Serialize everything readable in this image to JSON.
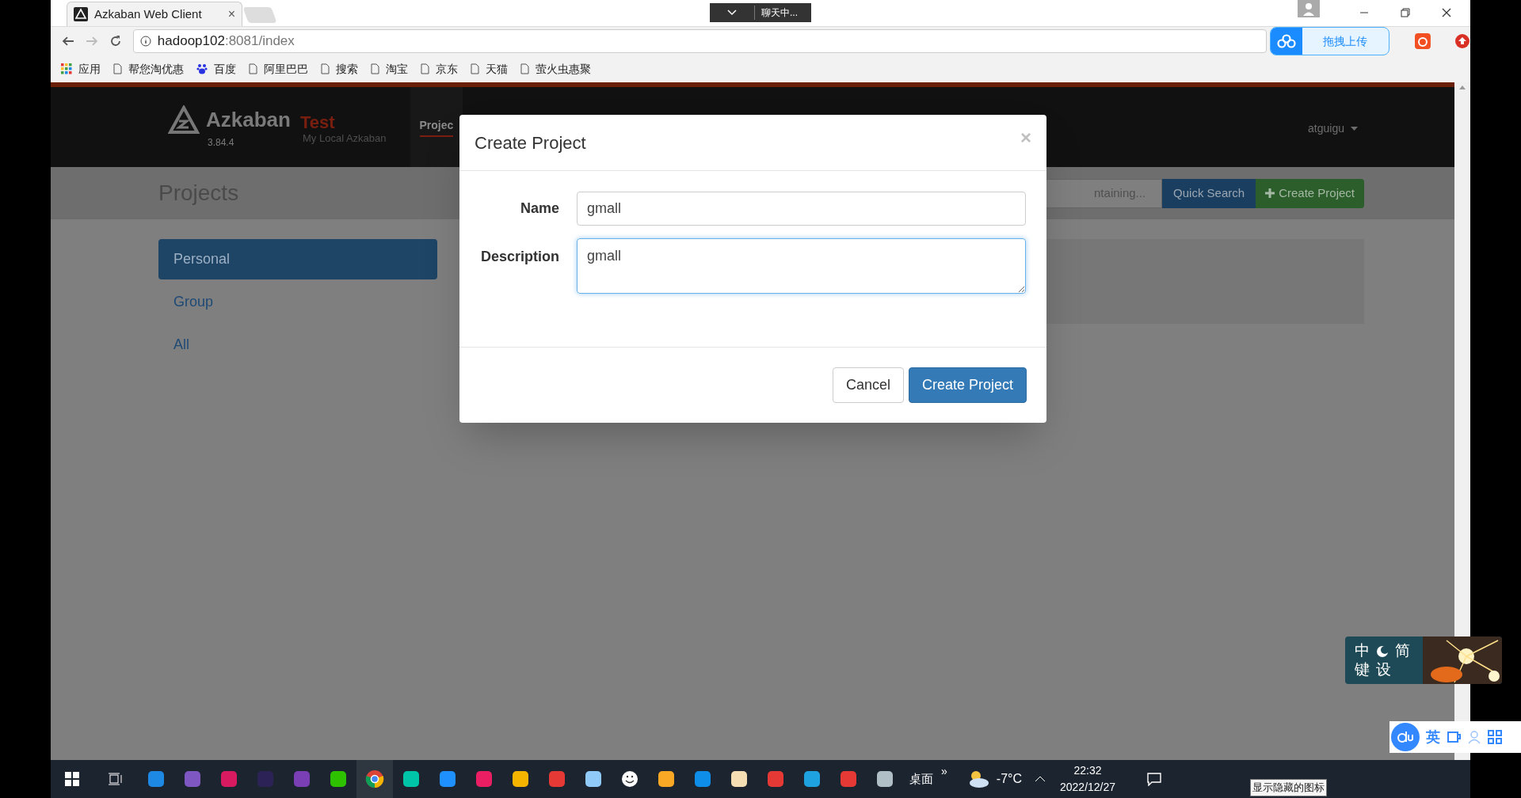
{
  "browser": {
    "tab_title": "Azkaban Web Client",
    "tab_close": "×",
    "chat_widget": "聊天中...",
    "url_host": "hadoop102",
    "url_rest": ":8081/index",
    "upload_button": "拖拽上传",
    "bookmarks": [
      {
        "label": "应用",
        "kind": "apps"
      },
      {
        "label": "帮您淘优惠",
        "kind": "page"
      },
      {
        "label": "百度",
        "kind": "paw"
      },
      {
        "label": "阿里巴巴",
        "kind": "page"
      },
      {
        "label": "搜索",
        "kind": "page"
      },
      {
        "label": "淘宝",
        "kind": "page"
      },
      {
        "label": "京东",
        "kind": "page"
      },
      {
        "label": "天猫",
        "kind": "page"
      },
      {
        "label": "萤火虫惠聚",
        "kind": "page"
      }
    ]
  },
  "header": {
    "brand": "Azkaban",
    "env": "Test",
    "version": "3.84.4",
    "env_desc": "My Local Azkaban",
    "nav": [
      {
        "label": "Projec",
        "selected": true
      }
    ],
    "user": "atguigu"
  },
  "page": {
    "title": "Projects",
    "search_placeholder": "ntaining...",
    "quick_search": "Quick Search",
    "create_project": "Create Project",
    "filters": [
      {
        "label": "Personal",
        "selected": true
      },
      {
        "label": "Group",
        "selected": false
      },
      {
        "label": "All",
        "selected": false
      }
    ]
  },
  "modal": {
    "title": "Create Project",
    "close": "×",
    "fields": [
      {
        "label": "Name",
        "value": "gmall",
        "kind": "input",
        "focused": false
      },
      {
        "label": "Description",
        "value": "gmall",
        "kind": "textarea",
        "focused": true
      }
    ],
    "cancel": "Cancel",
    "submit": "Create Project"
  },
  "ime": {
    "skin_top": [
      "中",
      "简"
    ],
    "skin_bottom": [
      "键",
      "设"
    ],
    "mode": "英"
  },
  "taskbar": {
    "desktop": "桌面",
    "more": "»",
    "weather": "-7°C",
    "time": "22:32",
    "date": "2022/12/27",
    "tooltip": "显示隐藏的图标"
  }
}
